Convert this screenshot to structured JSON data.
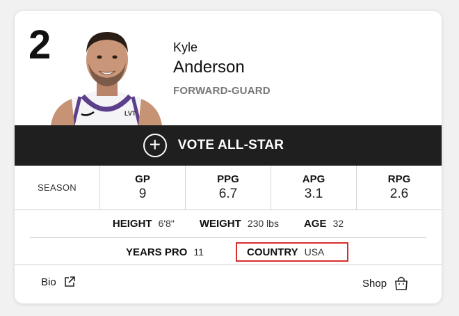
{
  "player": {
    "number": "2",
    "first_name": "Kyle",
    "last_name": "Anderson",
    "position": "FORWARD-GUARD",
    "jersey_text": "LVT"
  },
  "vote": {
    "label": "VOTE ALL-STAR",
    "icon": "plus-circle-icon"
  },
  "stats": {
    "season_label": "SEASON",
    "columns": [
      {
        "label": "GP",
        "value": "9"
      },
      {
        "label": "PPG",
        "value": "6.7"
      },
      {
        "label": "APG",
        "value": "3.1"
      },
      {
        "label": "RPG",
        "value": "2.6"
      }
    ]
  },
  "bio": {
    "height": {
      "label": "HEIGHT",
      "value": "6'8\""
    },
    "weight": {
      "label": "WEIGHT",
      "value": "230 lbs"
    },
    "age": {
      "label": "AGE",
      "value": "32"
    },
    "years_pro": {
      "label": "YEARS PRO",
      "value": "11"
    },
    "country": {
      "label": "COUNTRY",
      "value": "USA"
    }
  },
  "footer": {
    "bio_label": "Bio",
    "bio_icon": "external-link-icon",
    "shop_label": "Shop",
    "shop_icon": "shopping-bag-icon"
  },
  "colors": {
    "vote_bar": "#1f1f1f",
    "highlight_border": "#d62d2d",
    "position_text": "#777777"
  }
}
